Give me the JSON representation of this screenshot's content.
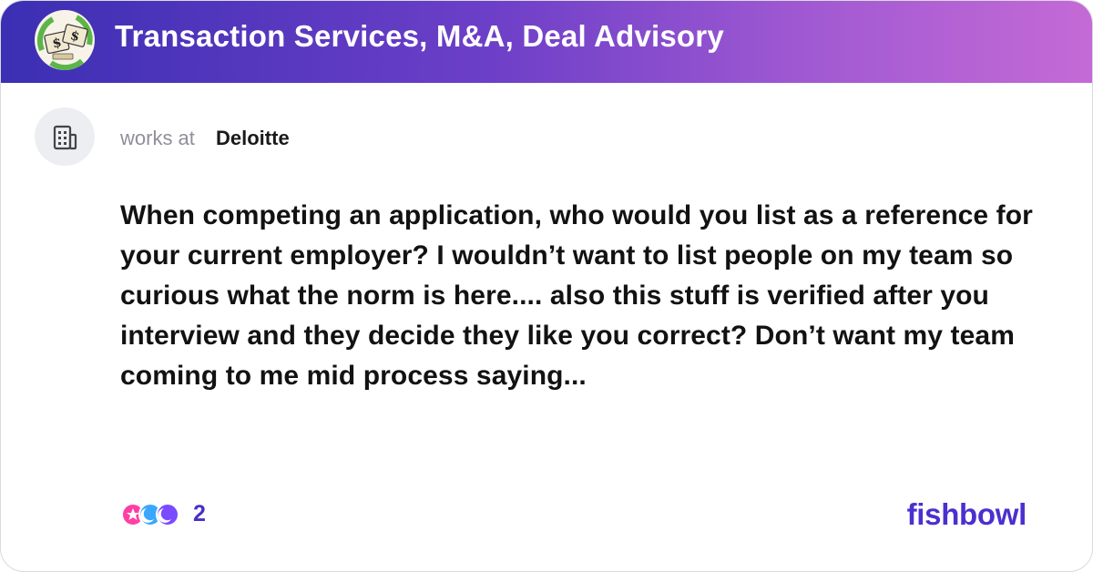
{
  "header": {
    "bowl_title": "Transaction Services, M&A, Deal Advisory",
    "bowl_icon": "money-recycle-icon"
  },
  "author": {
    "works_at_label": "works at",
    "company": "Deloitte",
    "avatar_icon": "building-icon"
  },
  "post": {
    "text": "When competing an application, who would you list as a reference for your current employer? I wouldn’t want to list people on my team so curious what the norm is here.... also this stuff is verified after you interview and they decide they like you correct? Don’t want my team coming to me mid process saying..."
  },
  "footer": {
    "reaction_count": "2",
    "brand": "fishbowl"
  },
  "colors": {
    "header_gradient_start": "#3b2fb3",
    "header_gradient_end": "#c46ad6",
    "brand": "#4b2fd0"
  }
}
